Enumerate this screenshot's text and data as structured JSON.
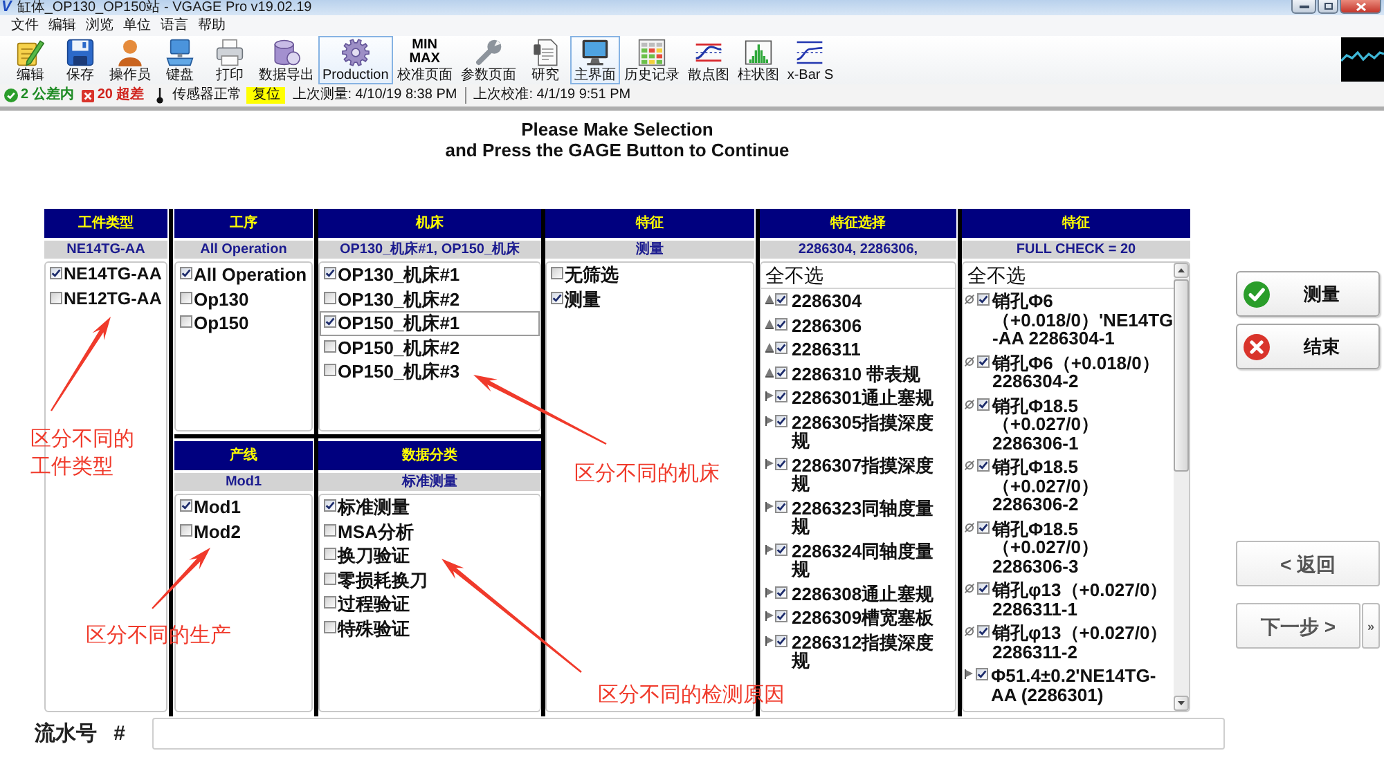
{
  "window": {
    "logo": "V",
    "title": "缸体_OP130_OP150站 - VGAGE Pro v19.02.19"
  },
  "menu": [
    "文件",
    "编辑",
    "浏览",
    "单位",
    "语言",
    "帮助"
  ],
  "toolbar": [
    {
      "kind": "edit",
      "label": "编辑",
      "selected": false
    },
    {
      "kind": "save",
      "label": "保存",
      "selected": false
    },
    {
      "kind": "operator",
      "label": "操作员",
      "selected": false
    },
    {
      "kind": "keyboard",
      "label": "键盘",
      "selected": false
    },
    {
      "kind": "print",
      "label": "打印",
      "selected": false
    },
    {
      "kind": "export",
      "label": "数据导出",
      "selected": false
    },
    {
      "kind": "gear",
      "label": "Production",
      "selected": true
    },
    {
      "kind": "minmax",
      "icon_text": [
        "MIN",
        "MAX"
      ],
      "label": "校准页面",
      "selected": false
    },
    {
      "kind": "wrench",
      "label": "参数页面",
      "selected": false
    },
    {
      "kind": "study",
      "label": "研究",
      "selected": false
    },
    {
      "kind": "monitor",
      "label": "主界面",
      "selected": true
    },
    {
      "kind": "history",
      "label": "历史记录",
      "selected": false
    },
    {
      "kind": "scatter",
      "label": "散点图",
      "selected": false
    },
    {
      "kind": "histogram",
      "label": "柱状图",
      "selected": false
    },
    {
      "kind": "xbar",
      "label": "x-Bar S",
      "selected": false
    }
  ],
  "status_bar": {
    "in_tolerance": "2 公差内",
    "out_of_tolerance": "20 超差",
    "sensor": "传感器正常",
    "reset": "复位",
    "last_measurement": "上次测量: 4/10/19 8:38 PM",
    "last_calibration": "上次校准: 4/1/19 9:51 PM"
  },
  "heading": [
    "Please Make Selection",
    "and Press the GAGE Button to Continue"
  ],
  "panels": {
    "part_type": {
      "title": "工件类型",
      "summary": "NE14TG-AA",
      "items": [
        {
          "label": "NE14TG-AA",
          "checked": true
        },
        {
          "label": "NE12TG-AA",
          "checked": false
        }
      ]
    },
    "operation": {
      "title": "工序",
      "summary": "All Operation",
      "items": [
        {
          "label": "All Operation",
          "checked": true
        },
        {
          "label": "Op130",
          "checked": false
        },
        {
          "label": "Op150",
          "checked": false
        }
      ]
    },
    "machine": {
      "title": "机床",
      "summary": "OP130_机床#1, OP150_机床",
      "items": [
        {
          "label": "OP130_机床#1",
          "checked": true,
          "focused": false
        },
        {
          "label": "OP130_机床#2",
          "checked": false,
          "focused": false
        },
        {
          "label": "OP150_机床#1",
          "checked": true,
          "focused": true
        },
        {
          "label": "OP150_机床#2",
          "checked": false,
          "focused": false
        },
        {
          "label": "OP150_机床#3",
          "checked": false,
          "focused": false
        }
      ]
    },
    "feature_filter": {
      "title": "特征",
      "summary": "测量",
      "items": [
        {
          "label": "无筛选",
          "checked": false
        },
        {
          "label": "测量",
          "checked": true
        }
      ]
    },
    "feature_select": {
      "title": "特征选择",
      "summary": "2286304, 2286306,",
      "select_none": "全不选",
      "items": [
        {
          "kind": "triangle",
          "label": "2286304",
          "checked": true
        },
        {
          "kind": "triangle",
          "label": "2286306",
          "checked": true
        },
        {
          "kind": "triangle",
          "label": "2286311",
          "checked": true
        },
        {
          "kind": "triangle",
          "label": "2286310 带表规",
          "checked": true
        },
        {
          "kind": "flag",
          "label": "2286301通止塞规",
          "checked": true
        },
        {
          "kind": "flag",
          "label": "2286305指摸深度规",
          "checked": true
        },
        {
          "kind": "flag",
          "label": "2286307指摸深度规",
          "checked": true
        },
        {
          "kind": "flag",
          "label": "2286323同轴度量规",
          "checked": true
        },
        {
          "kind": "flag",
          "label": "2286324同轴度量规",
          "checked": true
        },
        {
          "kind": "flag",
          "label": "2286308通止塞规",
          "checked": true
        },
        {
          "kind": "flag",
          "label": "2286309槽宽塞板",
          "checked": true
        },
        {
          "kind": "flag",
          "label": "2286312指摸深度规",
          "checked": true
        }
      ]
    },
    "features": {
      "title": "特征",
      "summary": "FULL CHECK = 20",
      "select_none": "全不选",
      "items": [
        {
          "kind": "diameter",
          "label": "销孔Φ6（+0.018/0）'NE14TG-AA 2286304-1",
          "checked": true
        },
        {
          "kind": "diameter",
          "label": "销孔Φ6（+0.018/0） 2286304-2",
          "checked": true
        },
        {
          "kind": "diameter",
          "label": "销孔Φ18.5（+0.027/0） 2286306-1",
          "checked": true
        },
        {
          "kind": "diameter",
          "label": "销孔Φ18.5（+0.027/0） 2286306-2",
          "checked": true
        },
        {
          "kind": "diameter",
          "label": "销孔Φ18.5（+0.027/0） 2286306-3",
          "checked": true
        },
        {
          "kind": "diameter",
          "label": "销孔φ13（+0.027/0） 2286311-1",
          "checked": true
        },
        {
          "kind": "diameter",
          "label": "销孔φ13（+0.027/0） 2286311-2",
          "checked": true
        },
        {
          "kind": "flag",
          "label": "Φ51.4±0.2'NE14TG-AA (2286301)",
          "checked": true
        }
      ]
    },
    "line": {
      "title": "产线",
      "summary": "Mod1",
      "items": [
        {
          "label": "Mod1",
          "checked": true
        },
        {
          "label": "Mod2",
          "checked": false
        }
      ]
    },
    "data_class": {
      "title": "数据分类",
      "summary": "标准测量",
      "items": [
        {
          "label": "标准测量",
          "checked": true
        },
        {
          "label": "MSA分析",
          "checked": false
        },
        {
          "label": "换刀验证",
          "checked": false
        },
        {
          "label": "零损耗换刀",
          "checked": false
        },
        {
          "label": "过程验证",
          "checked": false
        },
        {
          "label": "特殊验证",
          "checked": false
        }
      ]
    }
  },
  "actions": [
    {
      "kind": "ok",
      "label": "测量"
    },
    {
      "kind": "cancel",
      "label": "结束"
    }
  ],
  "navigation": {
    "back": "< 返回",
    "next": "下一步 >",
    "more": "»"
  },
  "serial": {
    "label": "流水号 #"
  },
  "annotations": [
    "区分不同的工件类型",
    "区分不同的生产",
    "区分不同的机床",
    "区分不同的检测原因"
  ]
}
